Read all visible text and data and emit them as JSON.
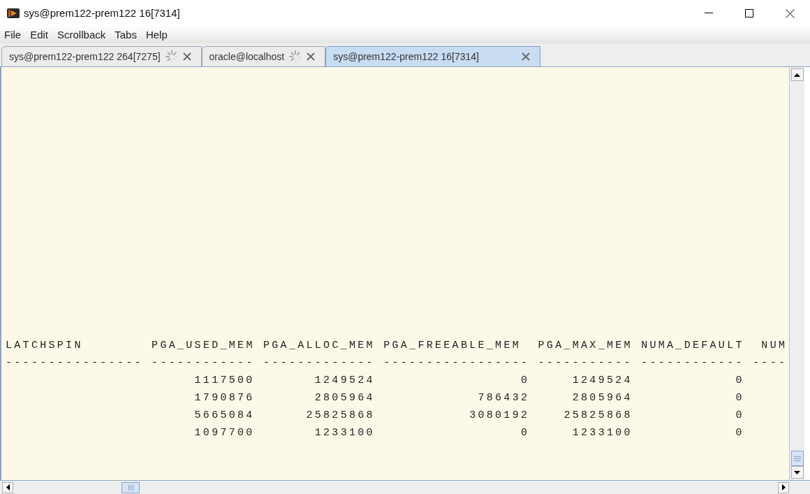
{
  "window": {
    "title": "sys@prem122-prem122 16[7314]"
  },
  "menu": [
    "File",
    "Edit",
    "Scrollback",
    "Tabs",
    "Help"
  ],
  "tabs": [
    {
      "label": "sys@prem122-prem122 264[7275]",
      "busy": true,
      "selected": false
    },
    {
      "label": "oracle@localhost",
      "busy": true,
      "selected": false
    },
    {
      "label": "sys@prem122-prem122 16[7314]",
      "busy": false,
      "selected": true
    }
  ],
  "terminal": {
    "columns": [
      "LATCHSPIN",
      "PGA_USED_MEM",
      "PGA_ALLOC_MEM",
      "PGA_FREEABLE_MEM",
      "PGA_MAX_MEM",
      "NUMA_DEFAULT",
      "NUM"
    ],
    "separators": [
      "----------------",
      "------------",
      "-------------",
      "-----------------",
      "-----------",
      "------------",
      "----"
    ],
    "rows": [
      [
        "",
        "1117500",
        "1249524",
        "0",
        "1249524",
        "0"
      ],
      [
        "",
        "1790876",
        "2805964",
        "786432",
        "2805964",
        "0"
      ],
      [
        "",
        "5665084",
        "25825868",
        "3080192",
        "25825868",
        "0"
      ],
      [
        "",
        "1097700",
        "1233100",
        "0",
        "1233100",
        "0"
      ]
    ]
  }
}
